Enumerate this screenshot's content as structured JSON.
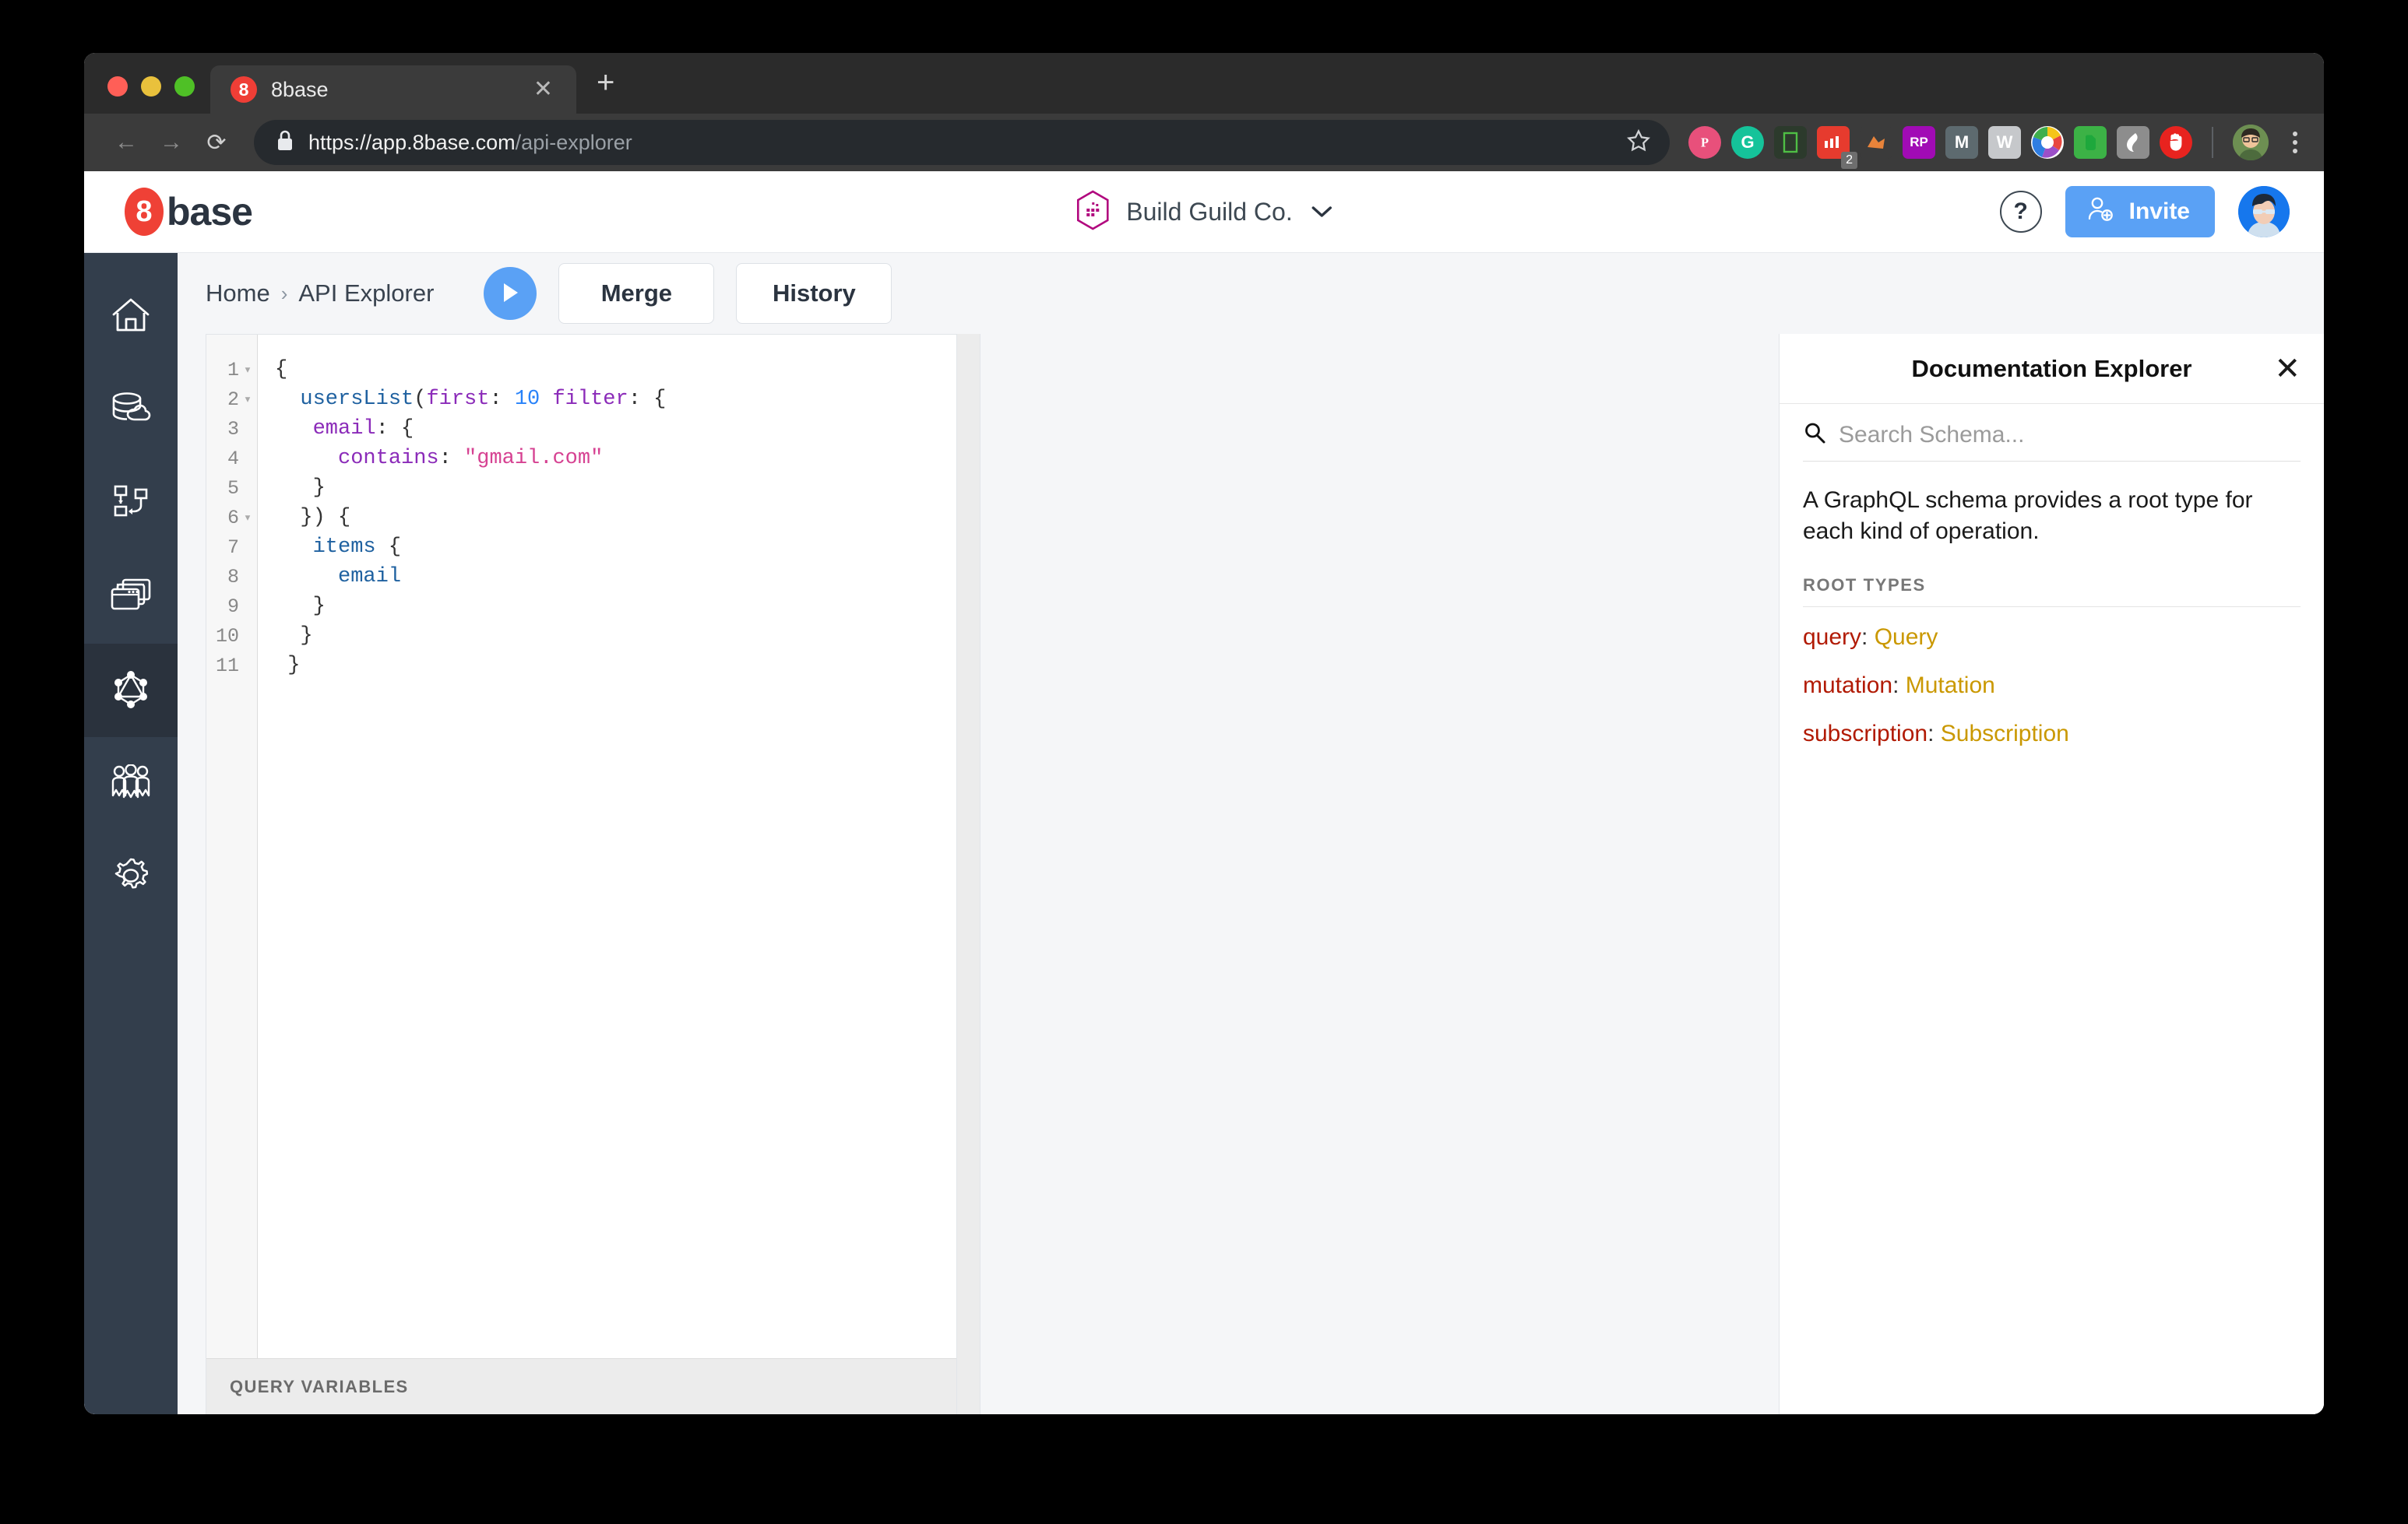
{
  "browser": {
    "tab": {
      "title": "8base",
      "favicon_label": "8",
      "close_label": "✕"
    },
    "new_tab_label": "+",
    "url_scheme_host": "https://app.8base.com",
    "url_path": "/api-explorer",
    "nav": {
      "back": "←",
      "forward": "→",
      "reload": "⟳"
    },
    "extensions": [
      {
        "name": "pinterest-extension-icon",
        "glyph": "❤",
        "color": "#e8507b",
        "shape": "circle"
      },
      {
        "name": "grammarly-extension-icon",
        "glyph": "G",
        "color": "#15c39a",
        "shape": "circle"
      },
      {
        "name": "responsive-viewer-extension-icon",
        "glyph": "▢",
        "color": "#2f3a2e",
        "shape": "square"
      },
      {
        "name": "clickup-extension-icon",
        "glyph": "•••",
        "color": "#e63b2e",
        "shape": "square",
        "badge": "2"
      },
      {
        "name": "firefox-pocket-extension-icon",
        "glyph": "🦊",
        "color": "#3b3b3b",
        "shape": "square"
      },
      {
        "name": "rp-extension-icon",
        "glyph": "RP",
        "color": "#a10bb5",
        "shape": "square"
      },
      {
        "name": "medium-extension-icon",
        "glyph": "M",
        "color": "#5d6a6f",
        "shape": "square"
      },
      {
        "name": "wikipedia-extension-icon",
        "glyph": "W",
        "color": "#c6c8cb",
        "shape": "square"
      },
      {
        "name": "color-wheel-extension-icon",
        "glyph": "●",
        "color": "#ffffff",
        "shape": "circle"
      },
      {
        "name": "evernote-extension-icon",
        "glyph": "🐘",
        "color": "#3cb246",
        "shape": "square"
      },
      {
        "name": "s-extension-icon",
        "glyph": "S",
        "color": "#8d8d8d",
        "shape": "square"
      },
      {
        "name": "adblock-extension-icon",
        "glyph": "✋",
        "color": "#e8231f",
        "shape": "circle"
      }
    ]
  },
  "header": {
    "brand_mark": "8",
    "brand_text": "base",
    "workspace_name": "Build Guild Co.",
    "workspace_caret": "⌄",
    "help_label": "?",
    "invite_label": "Invite"
  },
  "sidebar": {
    "items": [
      {
        "name": "home",
        "active": false
      },
      {
        "name": "data",
        "active": false
      },
      {
        "name": "workflow",
        "active": false
      },
      {
        "name": "apps",
        "active": false
      },
      {
        "name": "api-explorer",
        "active": true
      },
      {
        "name": "team",
        "active": false
      },
      {
        "name": "settings",
        "active": false
      }
    ]
  },
  "toolbar": {
    "breadcrumb": [
      "Home",
      "API Explorer"
    ],
    "breadcrumb_separator": "›",
    "merge_label": "Merge",
    "history_label": "History"
  },
  "editor": {
    "query_variables_label": "QUERY VARIABLES",
    "lines": [
      {
        "n": "1",
        "fold": true,
        "tokens": [
          {
            "t": "punct",
            "v": "{"
          }
        ]
      },
      {
        "n": "2",
        "fold": true,
        "tokens": [
          {
            "t": "punct",
            "v": "  "
          },
          {
            "t": "field",
            "v": "usersList"
          },
          {
            "t": "punct",
            "v": "("
          },
          {
            "t": "arg",
            "v": "first"
          },
          {
            "t": "punct",
            "v": ": "
          },
          {
            "t": "num",
            "v": "10"
          },
          {
            "t": "punct",
            "v": " "
          },
          {
            "t": "arg",
            "v": "filter"
          },
          {
            "t": "punct",
            "v": ": {"
          }
        ]
      },
      {
        "n": "3",
        "fold": false,
        "tokens": [
          {
            "t": "punct",
            "v": "   "
          },
          {
            "t": "arg",
            "v": "email"
          },
          {
            "t": "punct",
            "v": ": {"
          }
        ]
      },
      {
        "n": "4",
        "fold": false,
        "tokens": [
          {
            "t": "punct",
            "v": "     "
          },
          {
            "t": "arg",
            "v": "contains"
          },
          {
            "t": "punct",
            "v": ": "
          },
          {
            "t": "str",
            "v": "\"gmail.com\""
          }
        ]
      },
      {
        "n": "5",
        "fold": false,
        "tokens": [
          {
            "t": "punct",
            "v": "   }"
          }
        ]
      },
      {
        "n": "6",
        "fold": true,
        "tokens": [
          {
            "t": "punct",
            "v": "  }) {"
          }
        ]
      },
      {
        "n": "7",
        "fold": false,
        "tokens": [
          {
            "t": "punct",
            "v": "   "
          },
          {
            "t": "field",
            "v": "items"
          },
          {
            "t": "punct",
            "v": " {"
          }
        ]
      },
      {
        "n": "8",
        "fold": false,
        "tokens": [
          {
            "t": "punct",
            "v": "     "
          },
          {
            "t": "field",
            "v": "email"
          }
        ]
      },
      {
        "n": "9",
        "fold": false,
        "tokens": [
          {
            "t": "punct",
            "v": "   }"
          }
        ]
      },
      {
        "n": "10",
        "fold": false,
        "tokens": [
          {
            "t": "punct",
            "v": "  }"
          }
        ]
      },
      {
        "n": "11",
        "fold": false,
        "tokens": [
          {
            "t": "punct",
            "v": " }"
          }
        ]
      }
    ]
  },
  "docs": {
    "title": "Documentation Explorer",
    "close_label": "✕",
    "search_placeholder": "Search Schema...",
    "search_value": "",
    "description": "A GraphQL schema provides a root type for each kind of operation.",
    "root_types_label": "ROOT TYPES",
    "root_types": [
      {
        "field": "query",
        "type": "Query"
      },
      {
        "field": "mutation",
        "type": "Mutation"
      },
      {
        "field": "subscription",
        "type": "Subscription"
      }
    ]
  },
  "colors": {
    "accent_blue": "#5aa1f5",
    "sidebar_bg": "#333e4c",
    "brand_red": "#ef4136",
    "workspace_magenta": "#b1077e"
  }
}
